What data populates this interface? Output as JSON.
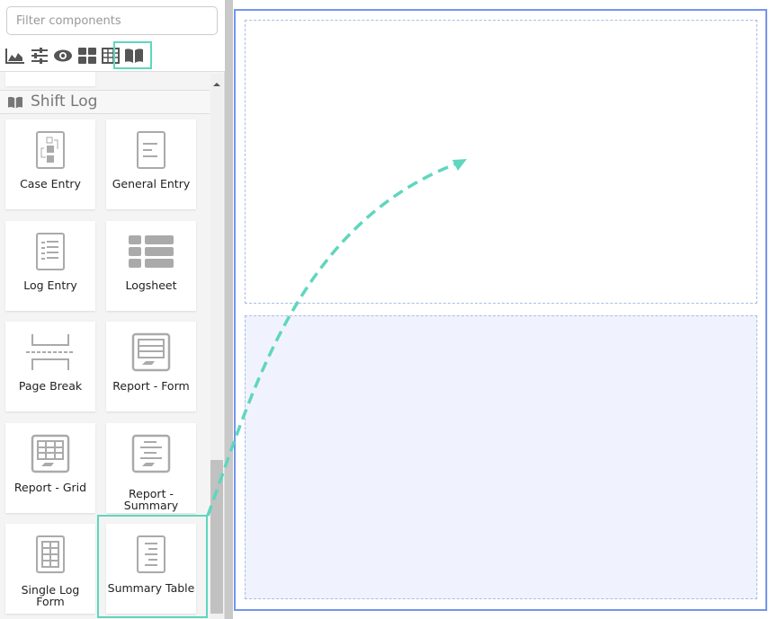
{
  "filter": {
    "placeholder": "Filter components"
  },
  "toolbar": {
    "icons": [
      "chart-area-icon",
      "sliders-icon",
      "eye-icon",
      "grid-icon",
      "table-icon",
      "book-icon"
    ]
  },
  "section": {
    "title": "Shift Log",
    "icon": "book-icon"
  },
  "components": [
    {
      "label": "Case Entry",
      "icon": "case-entry-icon"
    },
    {
      "label": "General Entry",
      "icon": "document-icon"
    },
    {
      "label": "Log Entry",
      "icon": "notebook-icon"
    },
    {
      "label": "Logsheet",
      "icon": "list-icon"
    },
    {
      "label": "Page Break",
      "icon": "page-break-icon"
    },
    {
      "label": "Report - Form",
      "icon": "report-form-icon"
    },
    {
      "label": "Report - Grid",
      "icon": "report-grid-icon"
    },
    {
      "label": "Report - Summary",
      "icon": "report-summary-icon"
    },
    {
      "label": "Single Log Form",
      "icon": "single-log-form-icon"
    },
    {
      "label": "Summary Table",
      "icon": "summary-table-icon"
    }
  ],
  "colors": {
    "highlight": "#5fd6be",
    "canvas_border": "#7395ec",
    "drop_zone": "#f0f3fd"
  }
}
